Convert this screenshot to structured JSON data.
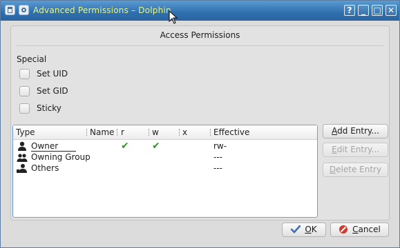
{
  "window": {
    "title": "Advanced Permissions – Dolphin",
    "controls": {
      "help": "?",
      "minimize": "_",
      "maximize": "□",
      "close": "✕"
    }
  },
  "group": {
    "title": "Access Permissions",
    "special_label": "Special",
    "checkboxes": [
      {
        "label": "Set UID",
        "checked": false
      },
      {
        "label": "Set GID",
        "checked": false
      },
      {
        "label": "Sticky",
        "checked": false
      }
    ]
  },
  "table": {
    "columns": [
      "Type",
      "Name",
      "r",
      "w",
      "x",
      "Effective"
    ],
    "rows": [
      {
        "type": "Owner",
        "icon": "user-icon",
        "r": true,
        "w": true,
        "x": false,
        "effective": "rw-"
      },
      {
        "type": "Owning Group",
        "icon": "group-icon",
        "r": false,
        "w": false,
        "x": false,
        "effective": "---"
      },
      {
        "type": "Others",
        "icon": "others-icon",
        "r": false,
        "w": false,
        "x": false,
        "effective": "---"
      }
    ],
    "check_glyph": "✔"
  },
  "buttons": {
    "add_entry": {
      "prefix": "A",
      "rest": "dd Entry...",
      "enabled": true
    },
    "edit_entry": {
      "prefix": "E",
      "rest": "dit Entry...",
      "enabled": false
    },
    "delete_entry": {
      "prefix": "D",
      "rest": "elete Entry",
      "enabled": false
    },
    "ok": {
      "prefix": "O",
      "rest": "K"
    },
    "cancel": {
      "prefix": "C",
      "rest": "ancel"
    }
  },
  "colors": {
    "titlebar": "#2f6fae",
    "title_text": "#e6f58a",
    "check_green": "#2e9a1f",
    "list_border": "#6aa0d6"
  }
}
